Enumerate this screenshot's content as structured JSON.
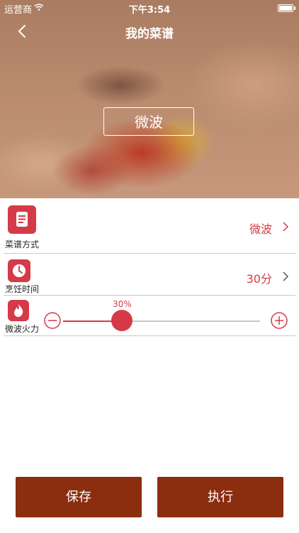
{
  "status_bar": {
    "carrier": "运营商",
    "time": "下午3:54"
  },
  "nav": {
    "title": "我的菜谱"
  },
  "hero": {
    "mode_badge": "微波"
  },
  "settings": {
    "recipe_mode": {
      "label": "菜谱方式",
      "value": "微波"
    },
    "cook_time": {
      "label": "烹饪时间",
      "value": "30分"
    },
    "power": {
      "label": "微波火力",
      "percent_text": "30%",
      "level": 0.3
    }
  },
  "actions": {
    "save_label": "保存",
    "run_label": "执行"
  },
  "colors": {
    "accent": "#d53a48",
    "button": "#8b2d0f",
    "divider": "#c8c8c8"
  }
}
